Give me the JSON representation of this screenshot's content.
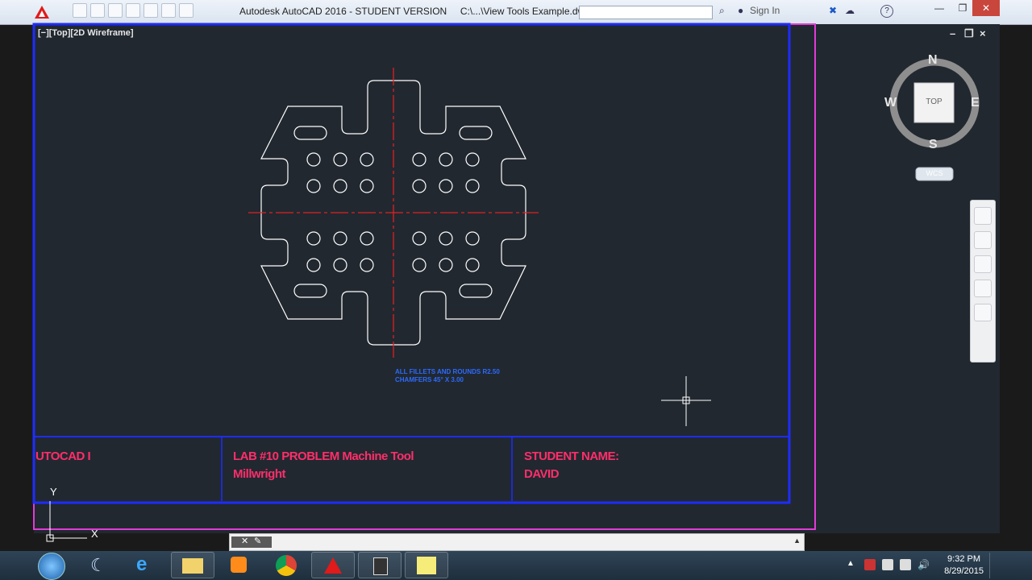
{
  "window": {
    "title": "Autodesk AutoCAD 2016 - STUDENT VERSION",
    "file": "C:\\...\\View Tools Example.dwg",
    "sign_in": "Sign In",
    "min": "—",
    "max": "❐",
    "close": "✕"
  },
  "viewport": {
    "label": "[−][Top][2D Wireframe]",
    "ctrl_min": "–",
    "ctrl_restore": "❐",
    "ctrl_close": "×"
  },
  "viewcube": {
    "north": "N",
    "south": "S",
    "east": "E",
    "west": "W",
    "face": "TOP",
    "wcs": "WCS"
  },
  "title_block": {
    "course": "UTOCAD I",
    "lab_line1": "LAB #10 PROBLEM Machine Tool",
    "lab_line2": "Millwright",
    "student_label": "STUDENT NAME:",
    "student_name": "DAVID"
  },
  "annotation": {
    "line1": "ALL FILLETS AND ROUNDS R2.50",
    "line2": "CHAMFERS 45° X 3.00"
  },
  "ucs": {
    "x": "X",
    "y": "Y"
  },
  "taskbar": {
    "time": "9:32 PM",
    "date": "8/29/2015"
  },
  "colors": {
    "background": "#212830",
    "geometry": "#ffffff",
    "centerline": "#e02020",
    "border_blue": "#1e2cff",
    "border_magenta": "#e23bd6",
    "title_text": "#ff2e6a"
  }
}
